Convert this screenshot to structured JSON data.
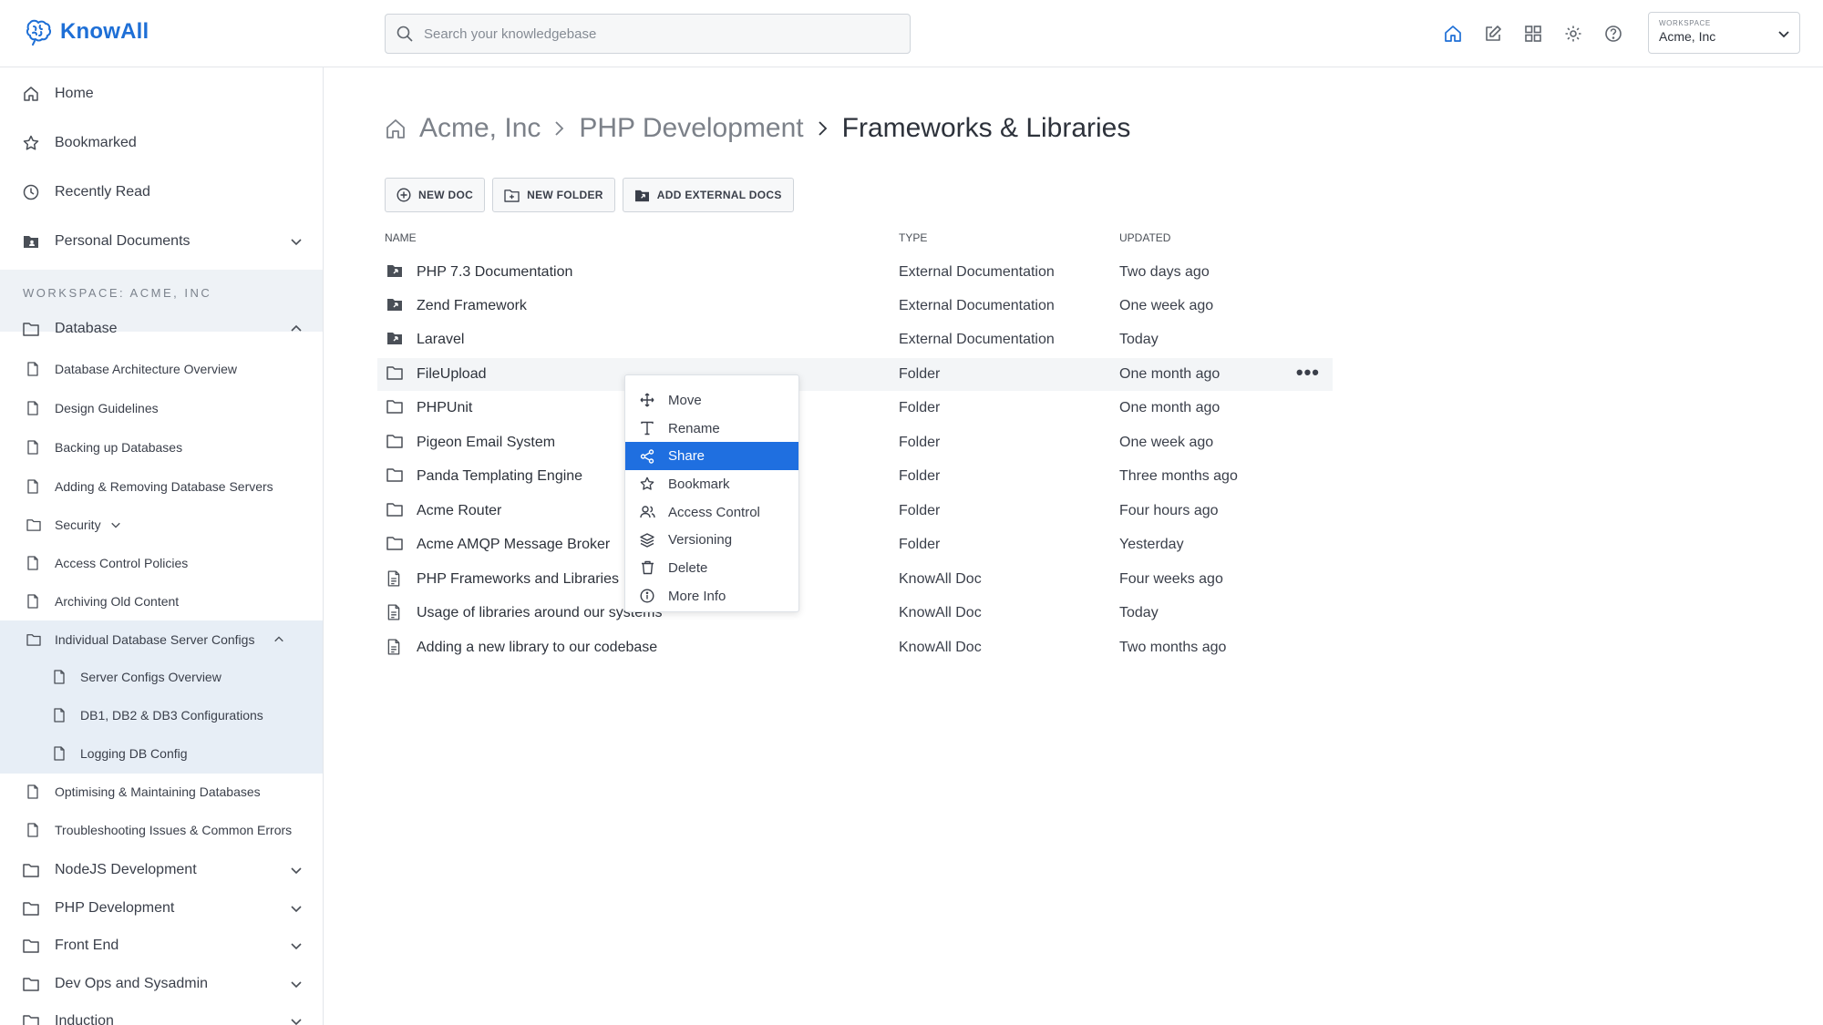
{
  "app": {
    "name": "KnowAll",
    "search_placeholder": "Search your knowledgebase",
    "workspace_label": "WORKSPACE",
    "workspace_value": "Acme, Inc",
    "accent_color": "#1e6fd6"
  },
  "top_icons": [
    "home-icon",
    "edit-icon",
    "grid-icon",
    "gear-icon",
    "help-icon"
  ],
  "sidebar": {
    "primary": [
      {
        "label": "Home",
        "icon": "home-icon"
      },
      {
        "label": "Bookmarked",
        "icon": "star-icon"
      },
      {
        "label": "Recently Read",
        "icon": "clock-icon"
      },
      {
        "label": "Personal Documents",
        "icon": "person-folder-icon"
      }
    ],
    "workspace_title": "WORKSPACE: ACME, INC",
    "tree": [
      {
        "label": "Database",
        "icon": "folder-icon",
        "level": 0,
        "expanded": true
      },
      {
        "label": "Database Architecture Overview",
        "icon": "doc-icon",
        "level": 1
      },
      {
        "label": "Design Guidelines",
        "icon": "doc-icon",
        "level": 1
      },
      {
        "label": "Backing up Databases",
        "icon": "doc-icon",
        "level": 1
      },
      {
        "label": "Adding & Removing Database Servers",
        "icon": "doc-icon",
        "level": 1
      },
      {
        "label": "Security",
        "icon": "folder-icon",
        "level": 1,
        "collapsed": true
      },
      {
        "label": "Access Control Policies",
        "icon": "doc-icon",
        "level": 1
      },
      {
        "label": "Archiving Old Content",
        "icon": "doc-icon",
        "level": 1
      },
      {
        "label": "Individual Database Server Configs",
        "icon": "folder-icon",
        "level": 1,
        "expanded": true
      },
      {
        "label": "Server Configs Overview",
        "icon": "doc-icon",
        "level": 2
      },
      {
        "label": "DB1, DB2 & DB3 Configurations",
        "icon": "doc-icon",
        "level": 2
      },
      {
        "label": "Logging DB Config",
        "icon": "doc-icon",
        "level": 2
      },
      {
        "label": "Optimising & Maintaining Databases",
        "icon": "doc-icon",
        "level": 1
      },
      {
        "label": "Troubleshooting Issues & Common Errors",
        "icon": "doc-icon",
        "level": 1
      },
      {
        "label": "NodeJS Development",
        "icon": "folder-icon",
        "level": 0
      },
      {
        "label": "PHP Development",
        "icon": "folder-icon",
        "level": 0
      },
      {
        "label": "Front End",
        "icon": "folder-icon",
        "level": 0
      },
      {
        "label": "Dev Ops and Sysadmin",
        "icon": "folder-icon",
        "level": 0
      },
      {
        "label": "Induction",
        "icon": "folder-icon",
        "level": 0
      }
    ]
  },
  "breadcrumb": {
    "items": [
      "Acme, Inc",
      "PHP Development"
    ],
    "current": "Frameworks & Libraries"
  },
  "actions": [
    {
      "label": "NEW DOC",
      "icon": "plus-circle-icon"
    },
    {
      "label": "NEW FOLDER",
      "icon": "folder-plus-icon"
    },
    {
      "label": "ADD EXTERNAL DOCS",
      "icon": "external-folder-icon"
    }
  ],
  "table": {
    "headers": {
      "name": "NAME",
      "type": "TYPE",
      "updated": "UPDATED"
    },
    "rows": [
      {
        "name": "PHP 7.3 Documentation",
        "type": "External Documentation",
        "updated": "Two days ago",
        "icon": "external-folder-icon"
      },
      {
        "name": "Zend Framework",
        "type": "External Documentation",
        "updated": "One week ago",
        "icon": "external-folder-icon"
      },
      {
        "name": "Laravel",
        "type": "External Documentation",
        "updated": "Today",
        "icon": "external-folder-icon"
      },
      {
        "name": "FileUpload",
        "type": "Folder",
        "updated": "One month ago",
        "icon": "folder-icon"
      },
      {
        "name": "PHPUnit",
        "type": "Folder",
        "updated": "One month ago",
        "icon": "folder-icon"
      },
      {
        "name": "Pigeon Email System",
        "type": "Folder",
        "updated": "One week ago",
        "icon": "folder-icon"
      },
      {
        "name": "Panda Templating Engine",
        "type": "Folder",
        "updated": "Three months ago",
        "icon": "folder-icon"
      },
      {
        "name": "Acme Router",
        "type": "Folder",
        "updated": "Four hours ago",
        "icon": "folder-icon"
      },
      {
        "name": "Acme AMQP Message Broker",
        "type": "Folder",
        "updated": "Yesterday",
        "icon": "folder-icon"
      },
      {
        "name": "PHP Frameworks and Libraries",
        "type": "KnowAll Doc",
        "updated": "Four weeks ago",
        "icon": "doc-icon"
      },
      {
        "name": "Usage of libraries around our systems",
        "type": "KnowAll Doc",
        "updated": "Today",
        "icon": "doc-icon"
      },
      {
        "name": "Adding a new library to our codebase",
        "type": "KnowAll Doc",
        "updated": "Two months ago",
        "icon": "doc-icon"
      }
    ],
    "more_label": "•••"
  },
  "context_menu": {
    "items": [
      {
        "label": "Move",
        "icon": "move-icon"
      },
      {
        "label": "Rename",
        "icon": "text-icon"
      },
      {
        "label": "Share",
        "icon": "share-icon"
      },
      {
        "label": "Bookmark",
        "icon": "star-icon"
      },
      {
        "label": "Access Control",
        "icon": "users-icon"
      },
      {
        "label": "Versioning",
        "icon": "layers-icon"
      },
      {
        "label": "Delete",
        "icon": "trash-icon"
      },
      {
        "label": "More Info",
        "icon": "info-icon"
      }
    ],
    "active": "Share",
    "active_color": "#1f6fe0"
  }
}
